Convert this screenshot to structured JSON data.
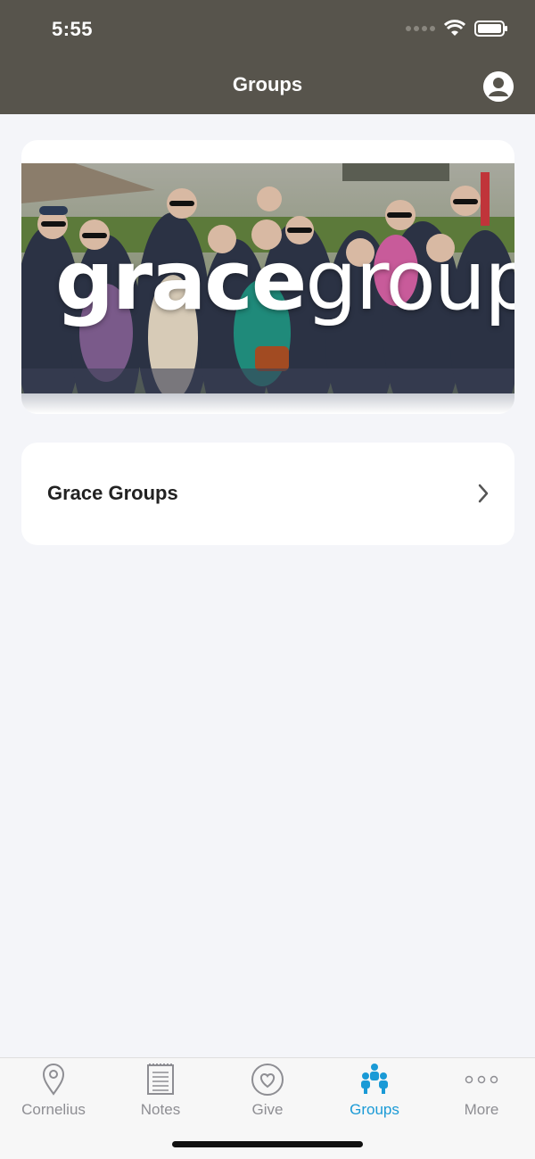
{
  "status": {
    "time": "5:55"
  },
  "header": {
    "title": "Groups",
    "profile_icon": "person-circle-icon"
  },
  "banner": {
    "word_bold": "grace",
    "word_light": "groups"
  },
  "list": {
    "items": [
      {
        "label": "Grace Groups"
      }
    ]
  },
  "tabs": [
    {
      "label": "Cornelius",
      "icon": "location-pin-icon",
      "active": false
    },
    {
      "label": "Notes",
      "icon": "notepad-icon",
      "active": false
    },
    {
      "label": "Give",
      "icon": "heart-circle-icon",
      "active": false
    },
    {
      "label": "Groups",
      "icon": "people-group-icon",
      "active": true
    },
    {
      "label": "More",
      "icon": "more-dots-icon",
      "active": false
    }
  ],
  "colors": {
    "header": "#57544c",
    "accent": "#1a9ad6",
    "inactive": "#8e8e93",
    "background": "#f4f5f9"
  }
}
